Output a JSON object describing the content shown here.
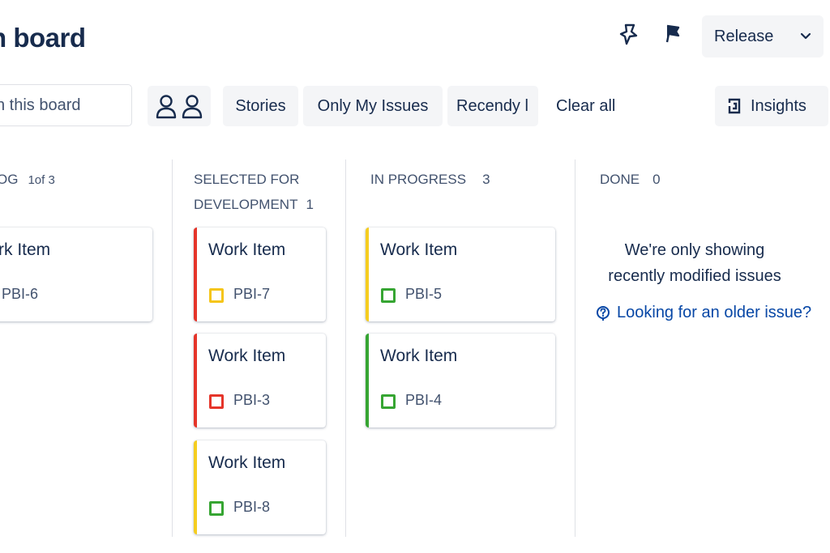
{
  "header": {
    "title": "n board",
    "release_label": "Release"
  },
  "toolbar": {
    "search_placeholder": "n this board",
    "filters": [
      "Stories",
      "Only My Issues",
      "Recendy l"
    ],
    "clear_all": "Clear all",
    "insights": "Insights"
  },
  "columns": [
    {
      "name": "OG",
      "count": "1of 3"
    },
    {
      "name": "SELECTED FOR",
      "name_line2": "DEVELOPMENT",
      "count": "1"
    },
    {
      "name": "IN PROGRESS",
      "count": "3"
    },
    {
      "name": "DONE",
      "count": "0"
    }
  ],
  "cards": [
    {
      "title": "rk Item",
      "key": "PBI-6"
    },
    {
      "title": "Work Item",
      "key": "PBI-7",
      "priority_color": "#e5352a",
      "type_color": "#f5c518"
    },
    {
      "title": "Work Item",
      "key": "PBI-3",
      "priority_color": "#e5352a",
      "type_color": "#e5352a"
    },
    {
      "title": "Work Item",
      "key": "PBI-8",
      "priority_color": "#f5cd20",
      "type_color": "#36a532"
    },
    {
      "title": "Work Item",
      "key": "PBI-5",
      "priority_color": "#f5cd20",
      "type_color": "#36a532"
    },
    {
      "title": "Work Item",
      "key": "PBI-4",
      "priority_color": "#36a532",
      "type_color": "#36a532"
    }
  ],
  "done_column": {
    "empty_line1": "We're only showing",
    "empty_line2": "recently modified issues",
    "older_link": "Looking for an older issue?"
  },
  "icons": {
    "pin": "pin-icon",
    "flag": "flag-icon",
    "chevron": "chevron-down-icon",
    "people": "user-avatar-icon",
    "insights": "insights-icon",
    "help": "question-circle-icon"
  },
  "colors": {
    "link": "#0747a6",
    "text": "#172b4d",
    "button_bg": "#f4f5f7"
  }
}
